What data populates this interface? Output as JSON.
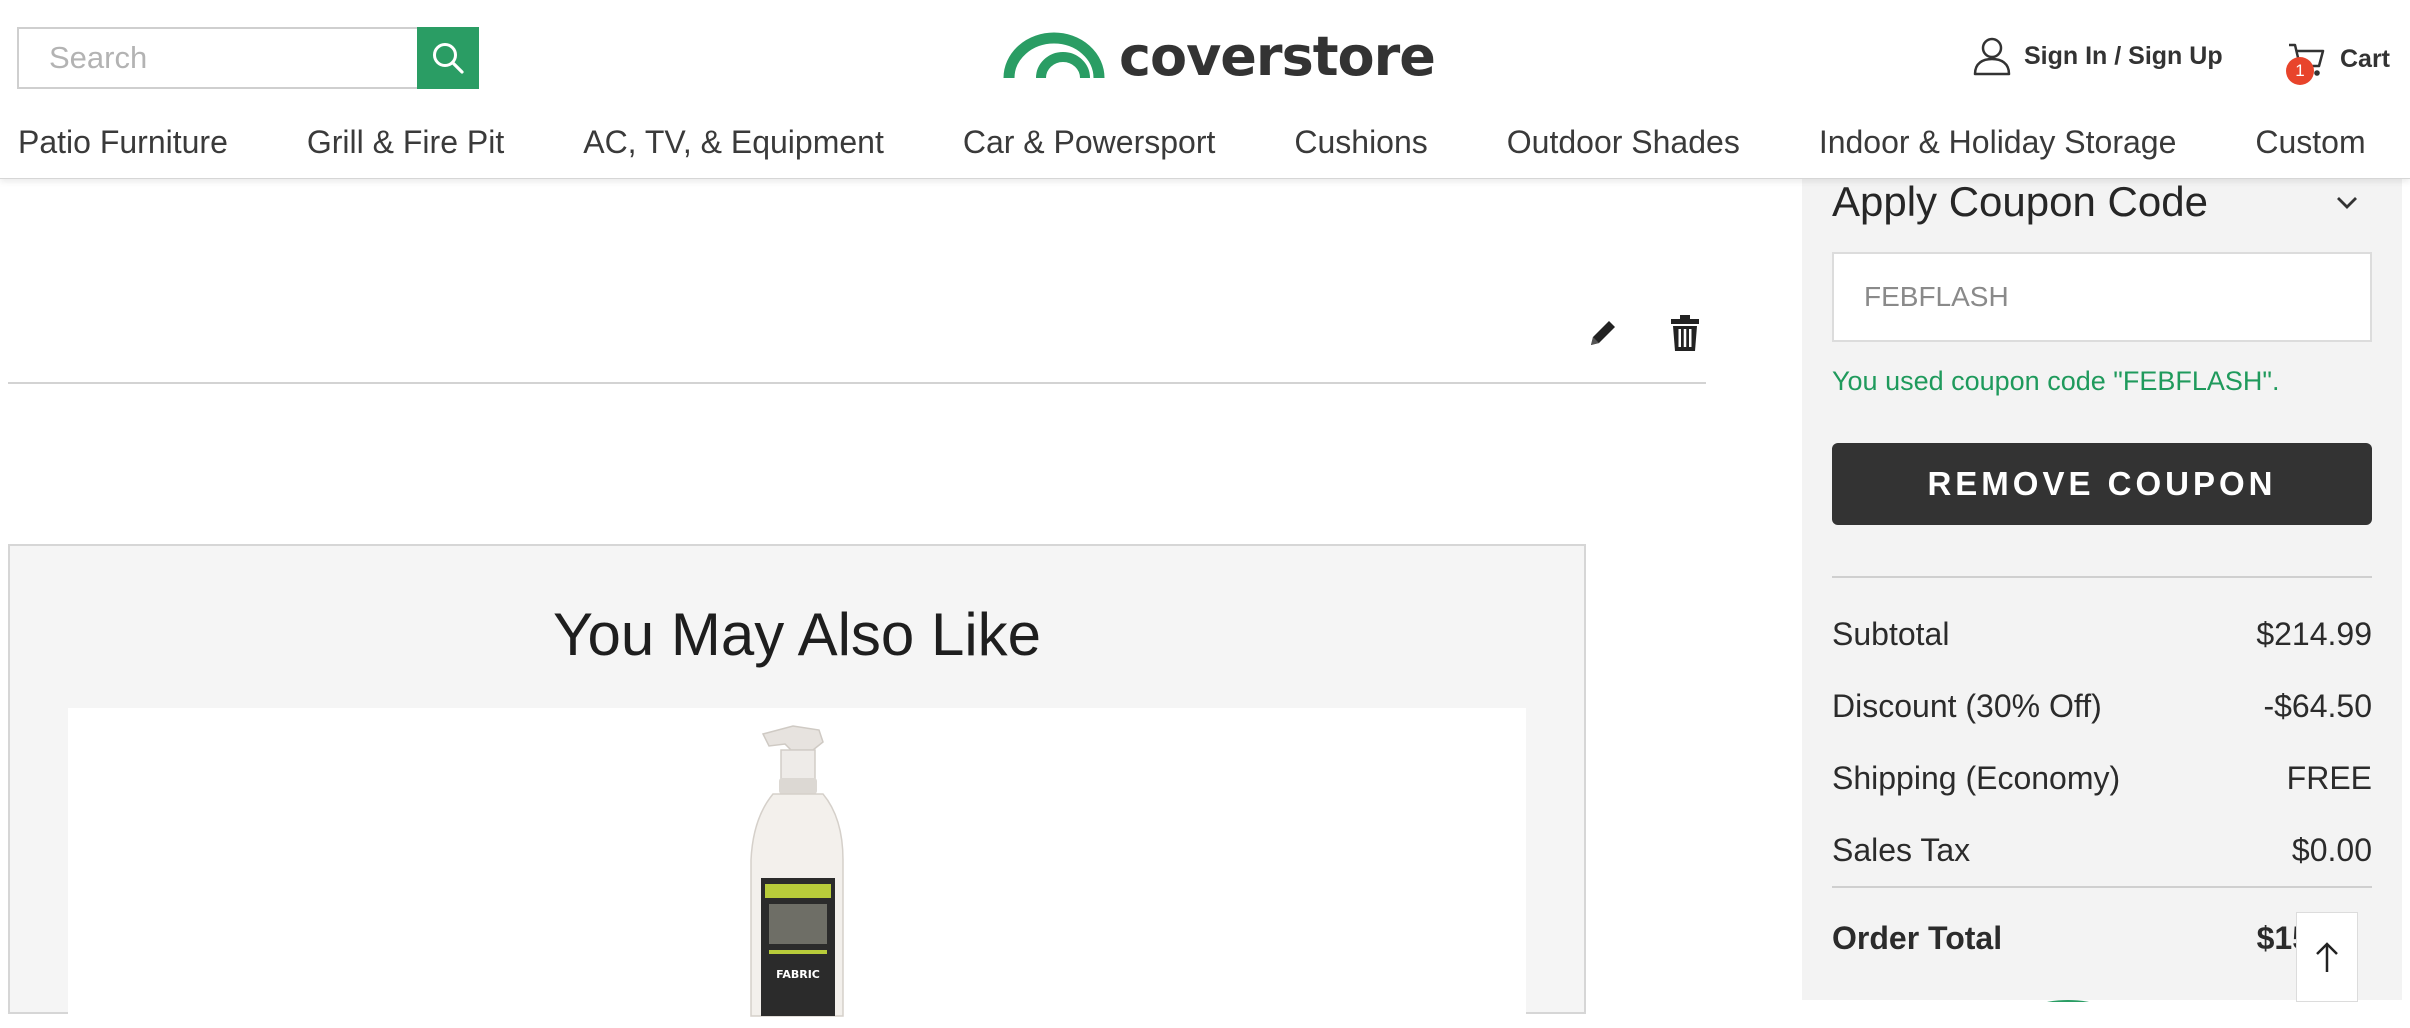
{
  "header": {
    "search": {
      "placeholder": "Search",
      "value": ""
    },
    "logo_text": "coverstore",
    "signin_label": "Sign In / Sign Up",
    "cart": {
      "label": "Cart",
      "count": "1"
    }
  },
  "nav": {
    "items": [
      "Patio Furniture",
      "Grill & Fire Pit",
      "AC, TV, & Equipment",
      "Car & Powersport",
      "Cushions",
      "Outdoor Shades",
      "Indoor & Holiday Storage",
      "Custom"
    ]
  },
  "recommendations": {
    "title": "You May Also Like",
    "product_label": "FABRIC"
  },
  "summary": {
    "coupon_title": "Apply Coupon Code",
    "coupon_value": "FEBFLASH",
    "coupon_message": "You used coupon code \"FEBFLASH\".",
    "remove_coupon_label": "REMOVE COUPON",
    "rows": [
      {
        "label": "Subtotal",
        "value": "$214.99"
      },
      {
        "label": "Discount (30% Off)",
        "value": "-$64.50"
      },
      {
        "label": "Shipping (Economy)",
        "value": "FREE"
      },
      {
        "label": "Sales Tax",
        "value": "$0.00"
      }
    ],
    "total": {
      "label": "Order Total",
      "value": "$15"
    }
  },
  "colors": {
    "brand_green": "#2a9d64",
    "success_text": "#1f9a5c",
    "button_dark": "#333333",
    "badge_red": "#e8442b"
  },
  "icons": [
    "search-icon",
    "coverstore-logo-arc",
    "user-icon",
    "cart-icon",
    "edit-pencil-icon",
    "trash-icon",
    "chevron-down-icon",
    "arrow-up-icon"
  ]
}
